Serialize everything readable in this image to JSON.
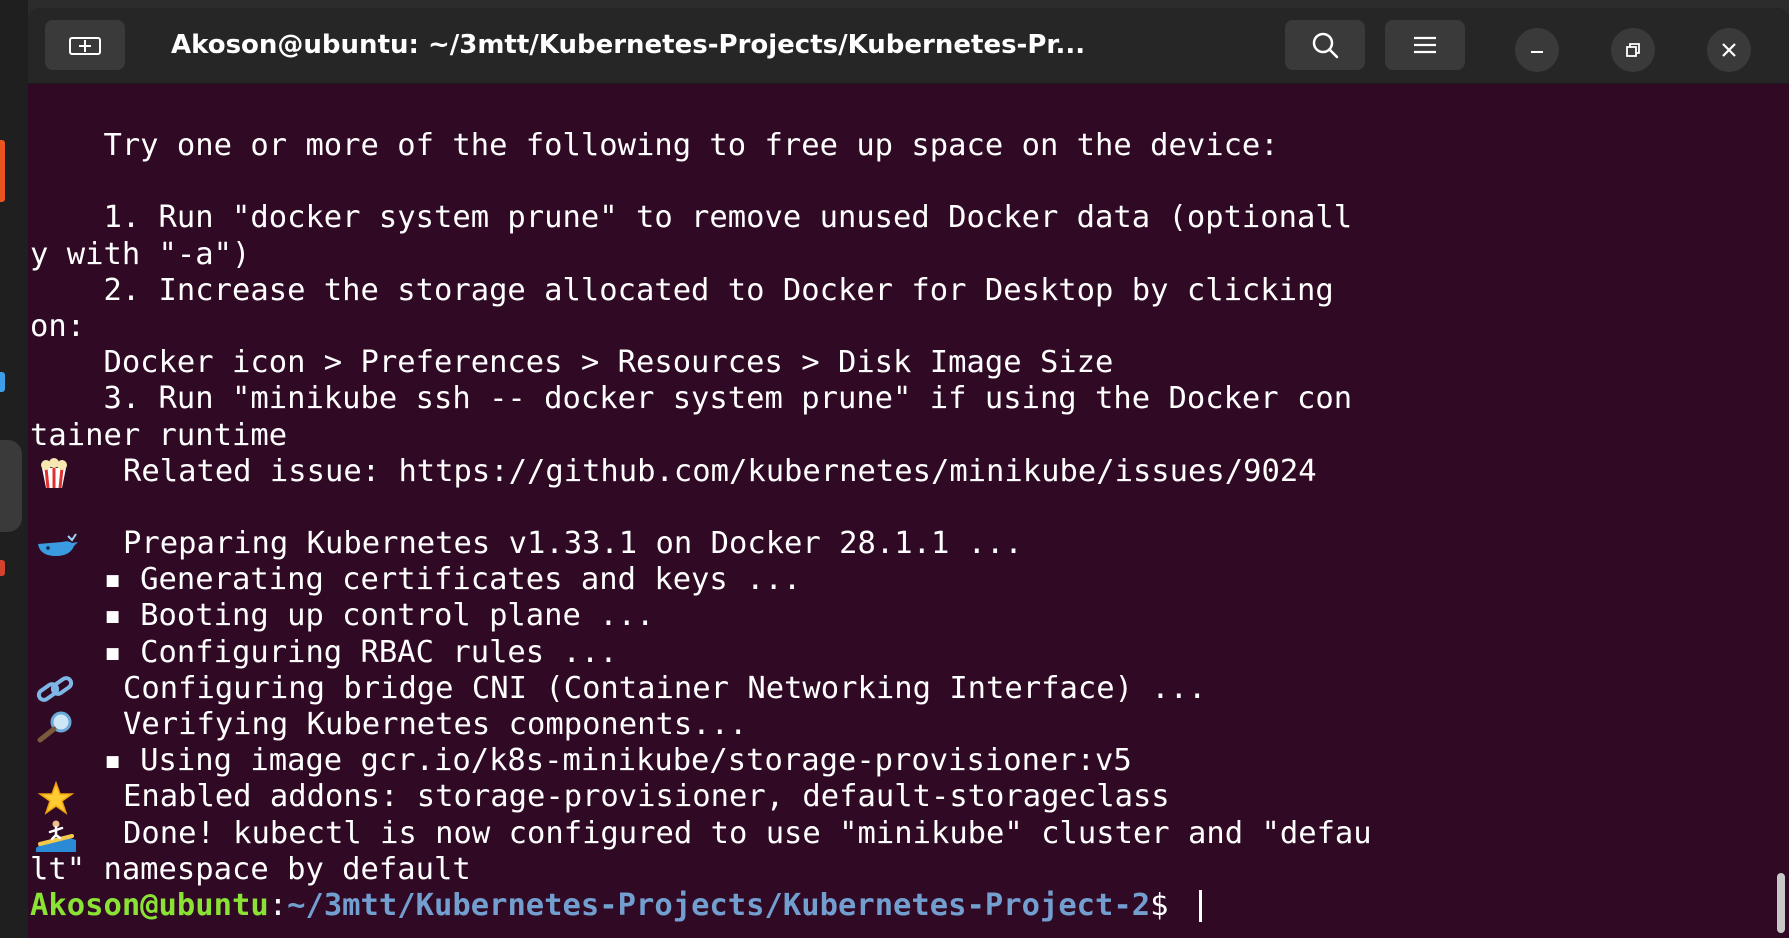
{
  "window": {
    "title": "Akoson@ubuntu: ~/3mtt/Kubernetes-Projects/Kubernetes-Pr..."
  },
  "terminal": {
    "lines": [
      {
        "text": "    Try one or more of the following to free up space on the device:"
      },
      {
        "text": ""
      },
      {
        "text": "    1. Run \"docker system prune\" to remove unused Docker data (optionall"
      },
      {
        "text": "y with \"-a\")"
      },
      {
        "text": "    2. Increase the storage allocated to Docker for Desktop by clicking"
      },
      {
        "text": "on:"
      },
      {
        "text": "    Docker icon > Preferences > Resources > Disk Image Size"
      },
      {
        "text": "    3. Run \"minikube ssh -- docker system prune\" if using the Docker con"
      },
      {
        "text": "tainer runtime"
      },
      {
        "icon": "popcorn-icon",
        "text": "Related issue: https://github.com/kubernetes/minikube/issues/9024"
      },
      {
        "text": ""
      },
      {
        "icon": "whale-icon",
        "text": "Preparing Kubernetes v1.33.1 on Docker 28.1.1 ..."
      },
      {
        "text": "    ▪ Generating certificates and keys ..."
      },
      {
        "text": "    ▪ Booting up control plane ..."
      },
      {
        "text": "    ▪ Configuring RBAC rules ..."
      },
      {
        "icon": "link-icon",
        "text": "Configuring bridge CNI (Container Networking Interface) ..."
      },
      {
        "icon": "magnifier-icon",
        "text": "Verifying Kubernetes components..."
      },
      {
        "text": "    ▪ Using image gcr.io/k8s-minikube/storage-provisioner:v5"
      },
      {
        "icon": "star-icon",
        "text": "Enabled addons: storage-provisioner, default-storageclass"
      },
      {
        "icon": "surfer-icon",
        "text": "Done! kubectl is now configured to use \"minikube\" cluster and \"defau"
      },
      {
        "text": "lt\" namespace by default"
      }
    ],
    "prompt": {
      "user": "Akoson@ubuntu",
      "separator": ":",
      "path": "~/3mtt/Kubernetes-Projects/Kubernetes-Project-2",
      "symbol": "$ "
    }
  },
  "colors": {
    "terminal_bg": "#300a24",
    "titlebar_bg": "#262626",
    "prompt_user": "#8ae234",
    "prompt_path": "#729fcf"
  }
}
